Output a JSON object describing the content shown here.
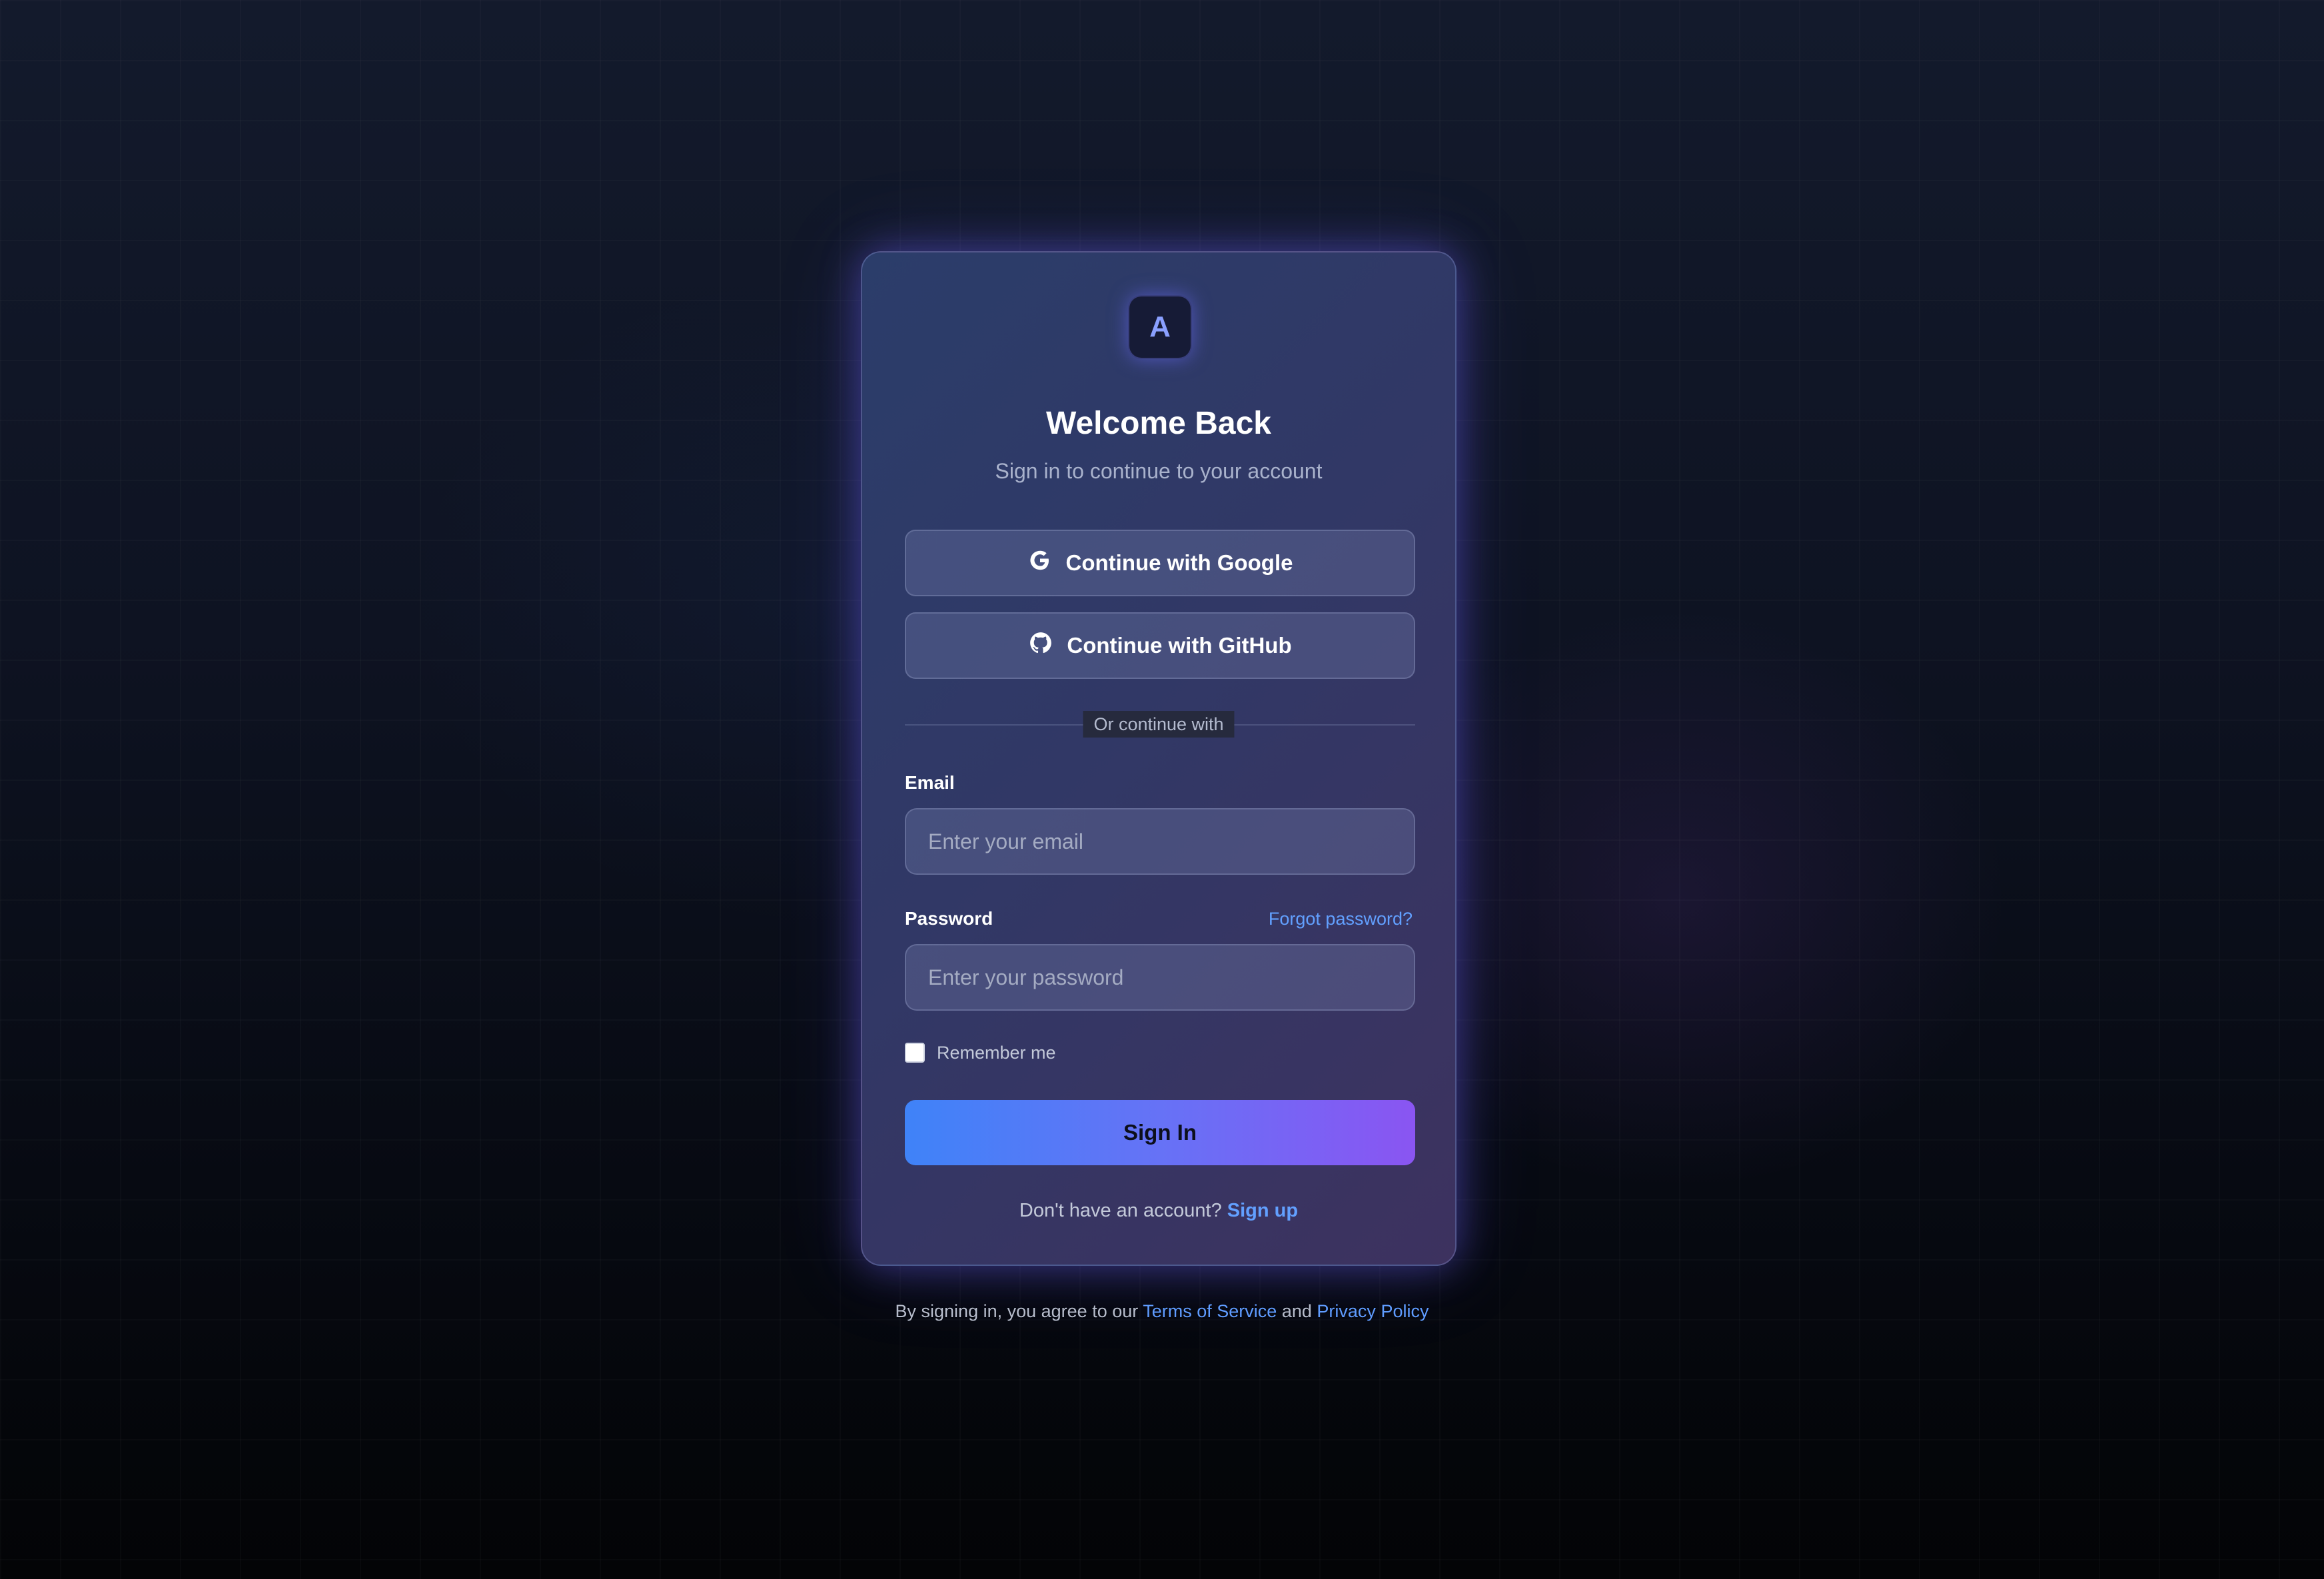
{
  "logo": {
    "letter": "A"
  },
  "header": {
    "title": "Welcome Back",
    "subtitle": "Sign in to continue to your account"
  },
  "social": {
    "google_label": "Continue with Google",
    "github_label": "Continue with GitHub",
    "google_icon": "google-icon",
    "github_icon": "github-icon"
  },
  "divider": {
    "label": "Or continue with"
  },
  "form": {
    "email_label": "Email",
    "email_placeholder": "Enter your email",
    "email_value": "",
    "password_label": "Password",
    "password_placeholder": "Enter your password",
    "password_value": "",
    "forgot_label": "Forgot password?",
    "remember_label": "Remember me",
    "remember_checked": false,
    "submit_label": "Sign In"
  },
  "signup": {
    "prompt": "Don't have an account?",
    "link": "Sign up"
  },
  "footer": {
    "prefix": "By signing in, you agree to our",
    "terms": "Terms of Service",
    "and": "and",
    "privacy": "Privacy Policy"
  },
  "colors": {
    "accent_link": "#62a0ff",
    "button_gradient_start": "#3f83f8",
    "button_gradient_end": "#8a55f2",
    "card_border_glow": "#6e64ff"
  }
}
